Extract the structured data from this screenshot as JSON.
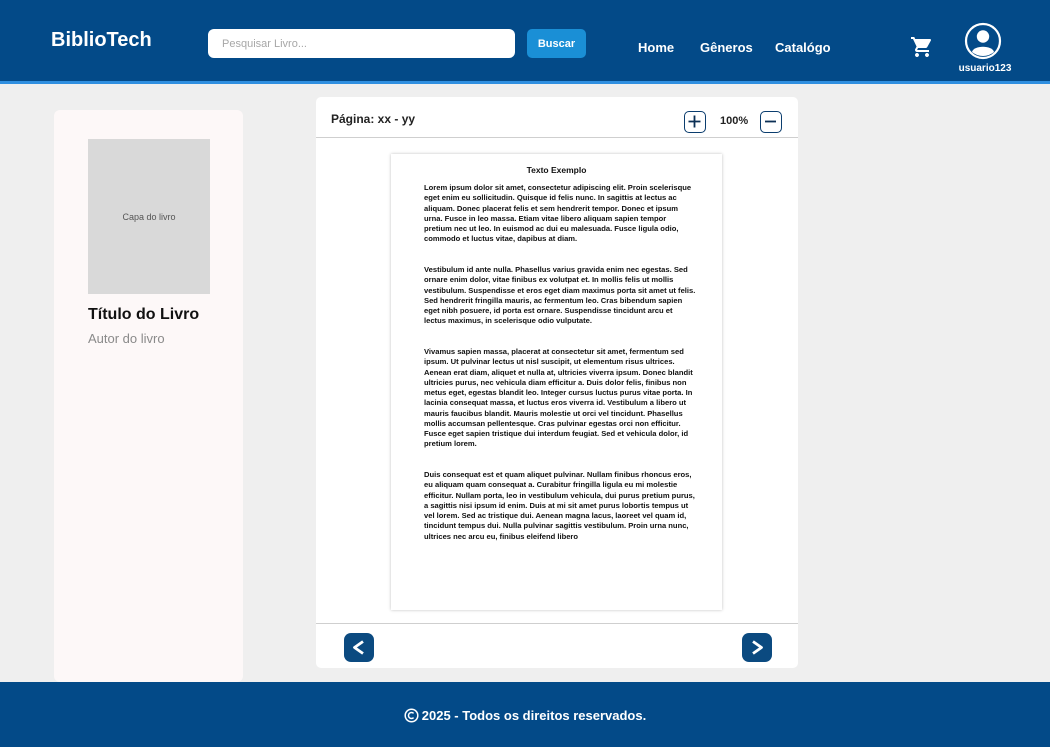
{
  "header": {
    "brand": "BiblioTech",
    "search": {
      "placeholder": "Pesquisar Livro...",
      "value": "",
      "button_label": "Buscar"
    },
    "nav": [
      {
        "label": "Home"
      },
      {
        "label": "Gêneros"
      },
      {
        "label": "Catalógo"
      }
    ],
    "cart_icon": "cart-icon",
    "user": {
      "icon": "user-avatar-icon",
      "name": "usuario123"
    }
  },
  "sidebar": {
    "cover_label": "Capa do livro",
    "title": "Título do Livro",
    "author": "Autor do livro"
  },
  "reader": {
    "page_indicator": "Página: xx - yy",
    "zoom_level": "100%",
    "zoom_in_icon": "plus-icon",
    "zoom_out_icon": "minus-icon",
    "page": {
      "heading": "Texto Exemplo",
      "paragraphs": [
        "Lorem ipsum dolor sit amet, consectetur adipiscing elit. Proin scelerisque eget enim eu sollicitudin. Quisque id felis nunc. In sagittis at lectus ac aliquam. Donec placerat felis et sem hendrerit tempor. Donec et ipsum urna. Fusce in leo massa. Etiam vitae libero aliquam sapien tempor pretium nec ut leo. In euismod ac dui eu malesuada. Fusce ligula odio, commodo et luctus vitae, dapibus at diam.",
        "Vestibulum id ante nulla. Phasellus varius gravida enim nec egestas. Sed ornare enim dolor, vitae finibus ex volutpat et. In mollis felis ut mollis vestibulum. Suspendisse et eros eget diam maximus porta sit amet ut felis. Sed hendrerit fringilla mauris, ac fermentum leo. Cras bibendum sapien eget nibh posuere, id porta est ornare. Suspendisse tincidunt arcu et lectus maximus, in scelerisque odio vulputate.",
        "Vivamus sapien massa, placerat at consectetur sit amet, fermentum sed ipsum. Ut pulvinar lectus ut nisl suscipit, ut elementum risus ultrices. Aenean erat diam, aliquet et nulla at, ultricies viverra ipsum. Donec blandit ultricies purus, nec vehicula diam efficitur a. Duis dolor felis, finibus non metus eget, egestas blandit leo. Integer cursus luctus purus vitae porta. In lacinia consequat massa, et luctus eros viverra id. Vestibulum a libero ut mauris faucibus blandit. Mauris molestie ut orci vel tincidunt. Phasellus mollis accumsan pellentesque. Cras pulvinar egestas orci non efficitur. Fusce eget sapien tristique dui interdum feugiat. Sed et vehicula dolor, id pretium lorem.",
        "Duis consequat est et quam aliquet pulvinar. Nullam finibus rhoncus eros, eu aliquam quam consequat a. Curabitur fringilla ligula eu mi molestie efficitur. Nullam porta, leo in vestibulum vehicula, dui purus pretium purus, a sagittis nisi ipsum id enim. Duis at mi sit amet purus lobortis tempus ut vel lorem. Sed ac tristique dui. Aenean magna lacus, laoreet vel quam id, tincidunt tempus dui. Nulla pulvinar sagittis vestibulum. Proin urna nunc, ultrices nec arcu eu, finibus eleifend libero"
      ]
    },
    "prev_icon": "chevron-left-icon",
    "next_icon": "chevron-right-icon"
  },
  "footer": {
    "copyright_icon": "copyright-icon",
    "text": "2025 - Todos os direitos reservados."
  },
  "colors": {
    "header_bg": "#034a88",
    "header_border": "#2f8fe0",
    "search_button": "#1a8fd6",
    "nav_button": "#0b4a80",
    "page_bg": "#efefef"
  }
}
